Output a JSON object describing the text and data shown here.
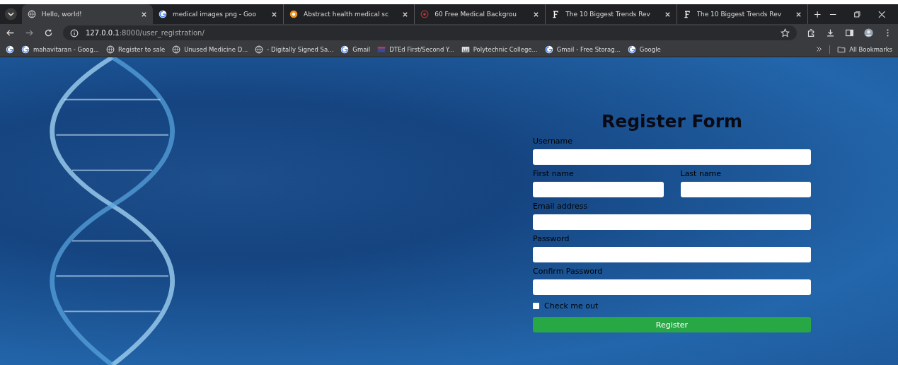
{
  "tabs": [
    {
      "title": "Hello, world!",
      "kind": "globe",
      "selected": true
    },
    {
      "title": "medical images png - Goo",
      "kind": "google",
      "selected": false
    },
    {
      "title": "Abstract health medical sc",
      "kind": "orange",
      "selected": false
    },
    {
      "title": "60 Free Medical Backgrou",
      "kind": "red",
      "selected": false
    },
    {
      "title": "The 10 Biggest Trends Rev",
      "kind": "letter",
      "selected": false
    },
    {
      "title": "The 10 Biggest Trends Rev",
      "kind": "letter",
      "selected": false
    }
  ],
  "address": {
    "host": "127.0.0.1",
    "path": ":8000/user_registration/"
  },
  "bookmarks": [
    {
      "kind": "google"
    },
    {
      "title": "mahavitaran - Goog...",
      "kind": "google"
    },
    {
      "title": "Register to sale",
      "kind": "globe"
    },
    {
      "title": "Unused Medicine D...",
      "kind": "globe"
    },
    {
      "title": "- Digitally Signed Sa...",
      "kind": "globe"
    },
    {
      "title": "Gmail",
      "kind": "google"
    },
    {
      "title": "DTEd First/Second Y...",
      "kind": "flag"
    },
    {
      "title": "Polytechnic College...",
      "kind": "building"
    },
    {
      "title": "Gmail - Free Storag...",
      "kind": "google"
    },
    {
      "title": "Google",
      "kind": "google"
    }
  ],
  "all_bookmarks": "All Bookmarks",
  "form": {
    "title": "Register Form",
    "rows": [
      [
        {
          "label": "Username"
        }
      ],
      [
        {
          "label": "First name"
        },
        {
          "label": "Last name"
        }
      ],
      [
        {
          "label": "Email address"
        }
      ],
      [
        {
          "label": "Password"
        }
      ],
      [
        {
          "label": "Confirm Password"
        }
      ]
    ],
    "checkbox": {
      "label": "Check me out",
      "checked": false
    },
    "button": "Register"
  }
}
